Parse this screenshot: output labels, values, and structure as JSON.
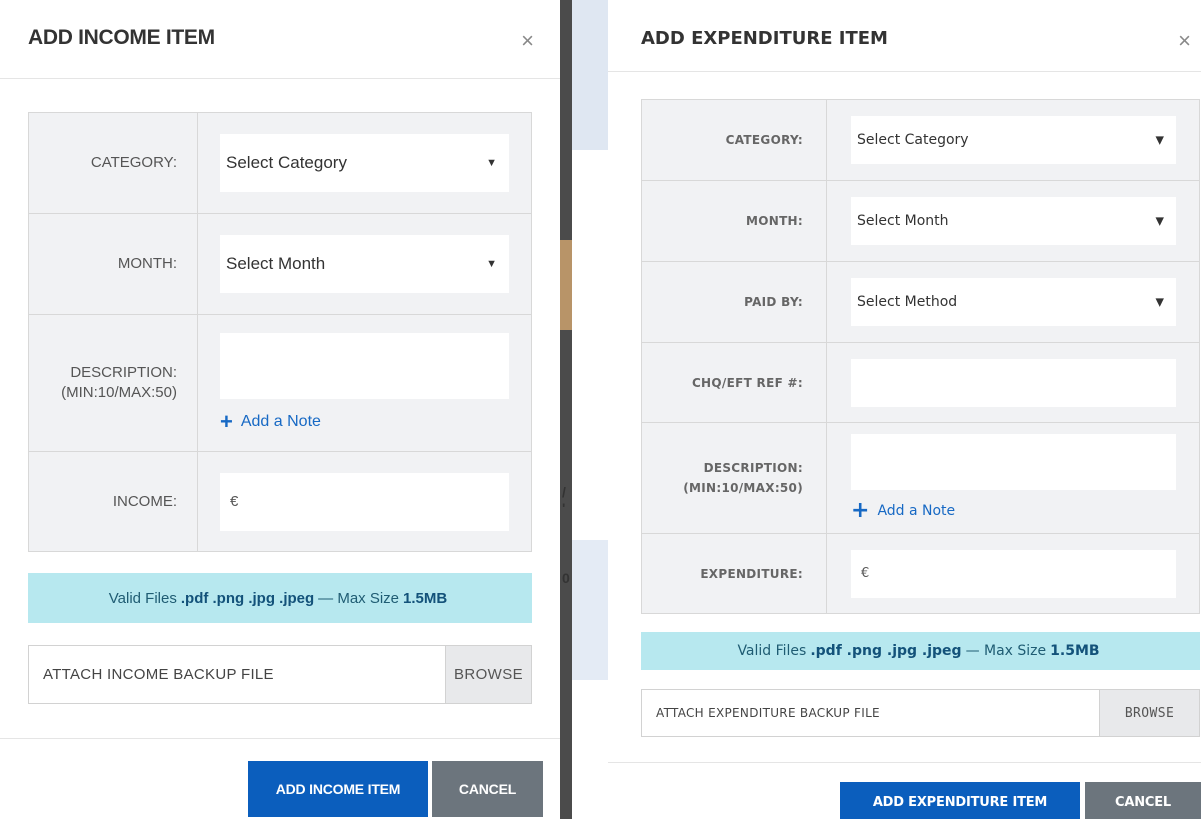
{
  "background": {
    "fragments": [
      "/",
      "'",
      "0"
    ]
  },
  "income_modal": {
    "title": "ADD INCOME ITEM",
    "close_glyph": "×",
    "fields": {
      "category_label": "CATEGORY:",
      "category_value": "Select Category",
      "month_label": "MONTH:",
      "month_value": "Select Month",
      "description_label_line1": "DESCRIPTION:",
      "description_label_line2": "(MIN:10/MAX:50)",
      "description_value": "",
      "add_note": "Add a Note",
      "income_label": "INCOME:",
      "income_prefix": "€"
    },
    "info": {
      "prefix": "Valid Files",
      "types": ".pdf .png .jpg .jpeg",
      "separator": "— Max Size",
      "size": "1.5MB"
    },
    "file_placeholder": "ATTACH INCOME BACKUP FILE",
    "browse_label": "BROWSE",
    "submit_label": "ADD INCOME ITEM",
    "cancel_label": "CANCEL"
  },
  "expenditure_modal": {
    "title": "ADD EXPENDITURE ITEM",
    "close_glyph": "×",
    "fields": {
      "category_label": "CATEGORY:",
      "category_value": "Select Category",
      "month_label": "MONTH:",
      "month_value": "Select Month",
      "paid_by_label": "PAID BY:",
      "paid_by_value": "Select Method",
      "ref_label": "CHQ/EFT REF #:",
      "ref_value": "",
      "description_label_line1": "DESCRIPTION:",
      "description_label_line2": "(MIN:10/MAX:50)",
      "description_value": "",
      "add_note": "Add a Note",
      "expenditure_label": "EXPENDITURE:",
      "expenditure_prefix": "€"
    },
    "info": {
      "prefix": "Valid Files",
      "types": ".pdf .png .jpg .jpeg",
      "separator": "— Max Size",
      "size": "1.5MB"
    },
    "file_placeholder": "ATTACH EXPENDITURE BACKUP FILE",
    "browse_label": "BROWSE",
    "submit_label": "ADD EXPENDITURE ITEM",
    "cancel_label": "CANCEL"
  },
  "colors": {
    "primary_button": "#0b5ebd",
    "secondary_button": "#6c757d",
    "info_background": "#b7e8ef",
    "link": "#1769c4",
    "table_background": "#f1f2f4"
  },
  "icons": {
    "close": "close-icon",
    "dropdown": "caret-down-icon",
    "add": "plus-icon"
  }
}
